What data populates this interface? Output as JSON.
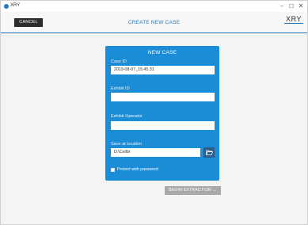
{
  "window": {
    "app_name": "XRY",
    "minimize_glyph": "–",
    "maximize_glyph": "☐",
    "close_glyph": "✕"
  },
  "toolbar": {
    "cancel_label": "CANCEL",
    "title": "CREATE NEW CASE",
    "brand": "XRY"
  },
  "form": {
    "title": "NEW CASE",
    "case_id": {
      "label": "Case ID",
      "value": "2019-08-07_15.45.31"
    },
    "exhibit_id": {
      "label": "Exhibit ID",
      "value": ""
    },
    "exhibit_operator": {
      "label": "Exhibit Operator",
      "value": ""
    },
    "save_location": {
      "label": "Save at location",
      "value": "D:\\Cellbr"
    },
    "protect_password": {
      "label": "Protect with password",
      "checked": false
    },
    "folder_icon": "folder-open-icon"
  },
  "actions": {
    "begin_label": "BEGIN EXTRACTION →"
  },
  "colors": {
    "accent": "#1f79c3",
    "card": "#1b8cd6",
    "cancel_bg": "#2c2c2c",
    "begin_bg": "#a9a9a9"
  }
}
